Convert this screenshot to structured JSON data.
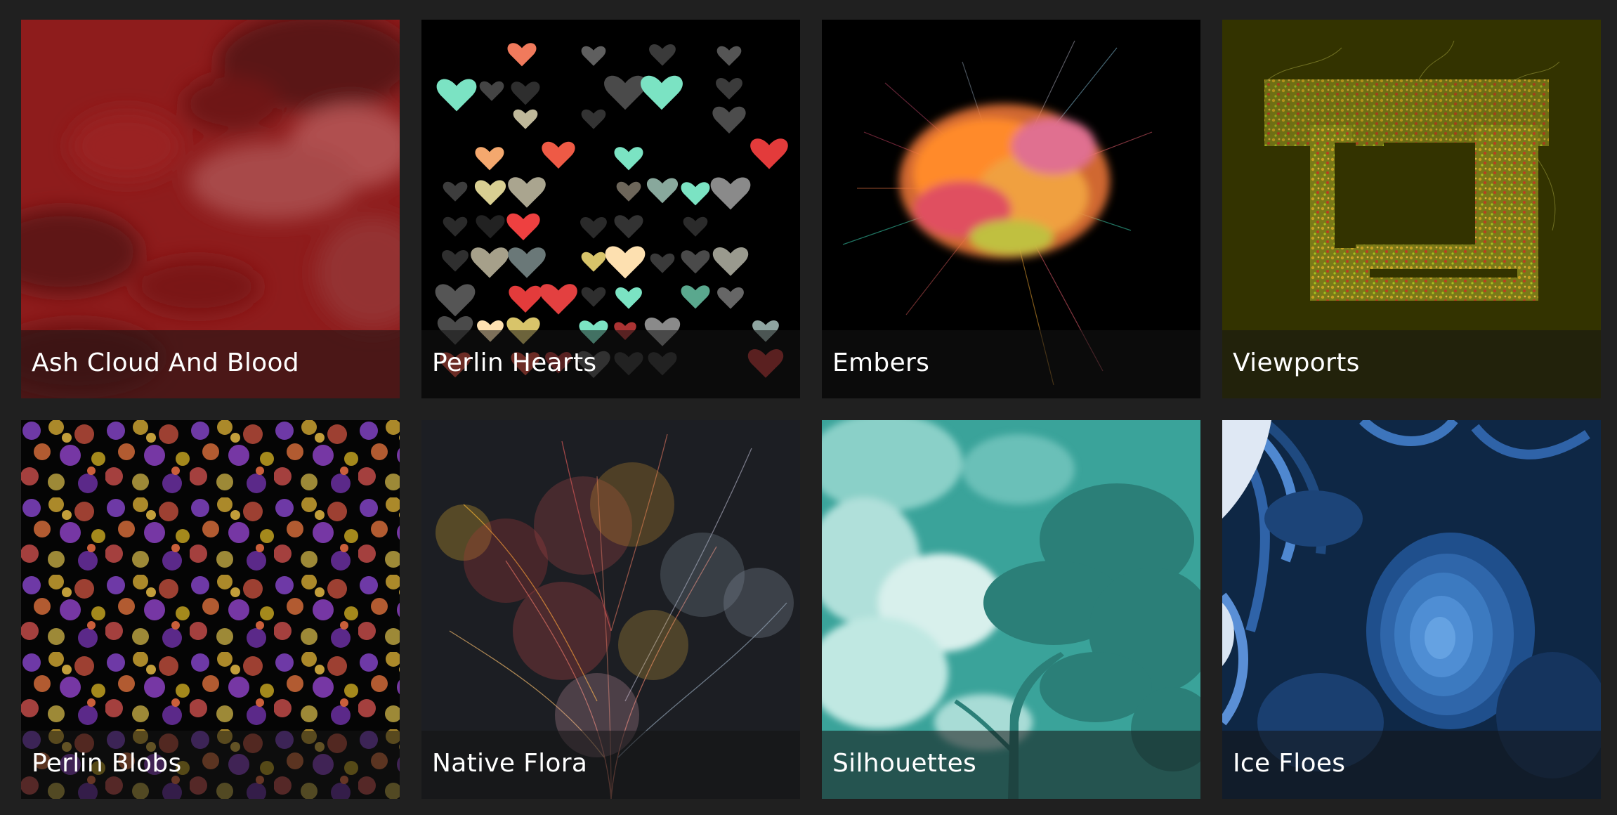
{
  "gallery": {
    "items": [
      {
        "title": "Ash Cloud And Blood",
        "background": "#8b1a1a"
      },
      {
        "title": "Perlin Hearts",
        "background": "#000000"
      },
      {
        "title": "Embers",
        "background": "#000000"
      },
      {
        "title": "Viewports",
        "background": "#333300"
      },
      {
        "title": "Perlin Blobs",
        "background": "#050505"
      },
      {
        "title": "Native Flora",
        "background": "#1c1e23"
      },
      {
        "title": "Silhouettes",
        "background": "#3aa39a"
      },
      {
        "title": "Ice Floes",
        "background": "#0e2745"
      }
    ]
  },
  "colors": {
    "page_background": "#202020",
    "caption_text": "#ffffff"
  }
}
